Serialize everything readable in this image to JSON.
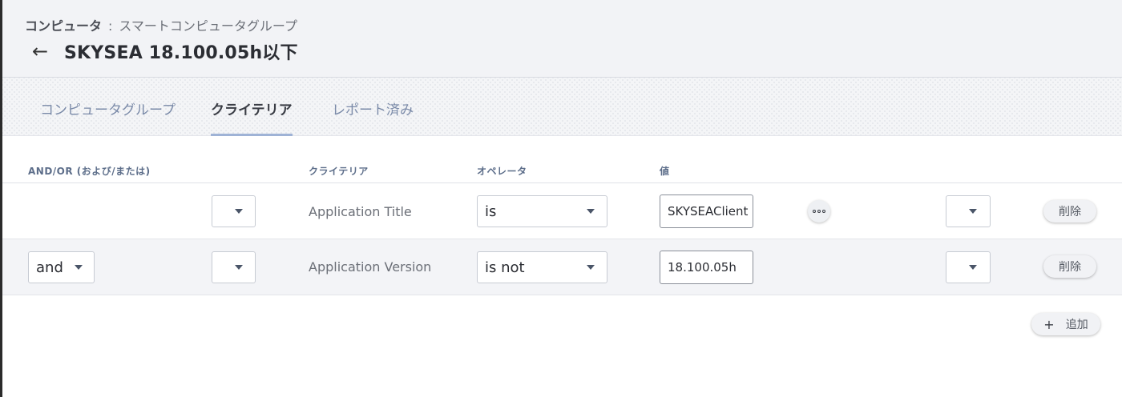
{
  "header": {
    "breadcrumb_root": "コンピュータ",
    "breadcrumb_separator": ":",
    "breadcrumb_current": "スマートコンピュータグループ",
    "back_icon": "←",
    "title": "SKYSEA 18.100.05h以下"
  },
  "tabs": [
    {
      "label": "コンピュータグループ",
      "active": false
    },
    {
      "label": "クライテリア",
      "active": true
    },
    {
      "label": "レポート済み",
      "active": false
    }
  ],
  "table": {
    "headers": {
      "and_or": "AND/OR (および/または)",
      "criteria": "クライテリア",
      "operator": "オペレータ",
      "value": "値"
    },
    "rows": [
      {
        "and_or": "",
        "criteria": "Application Title",
        "operator": "is",
        "value": "SKYSEAClient",
        "delete_label": "削除"
      },
      {
        "and_or": "and",
        "criteria": "Application Version",
        "operator": "is not",
        "value": "18.100.05h",
        "delete_label": "削除"
      }
    ]
  },
  "add_button": {
    "icon": "+",
    "label": "追加"
  },
  "colors": {
    "header_bg": "#f2f3f6",
    "tab_active_underline": "#9fb3d6",
    "tab_inactive_text": "#7a8aa8",
    "column_header_text": "#5d6e8a"
  }
}
